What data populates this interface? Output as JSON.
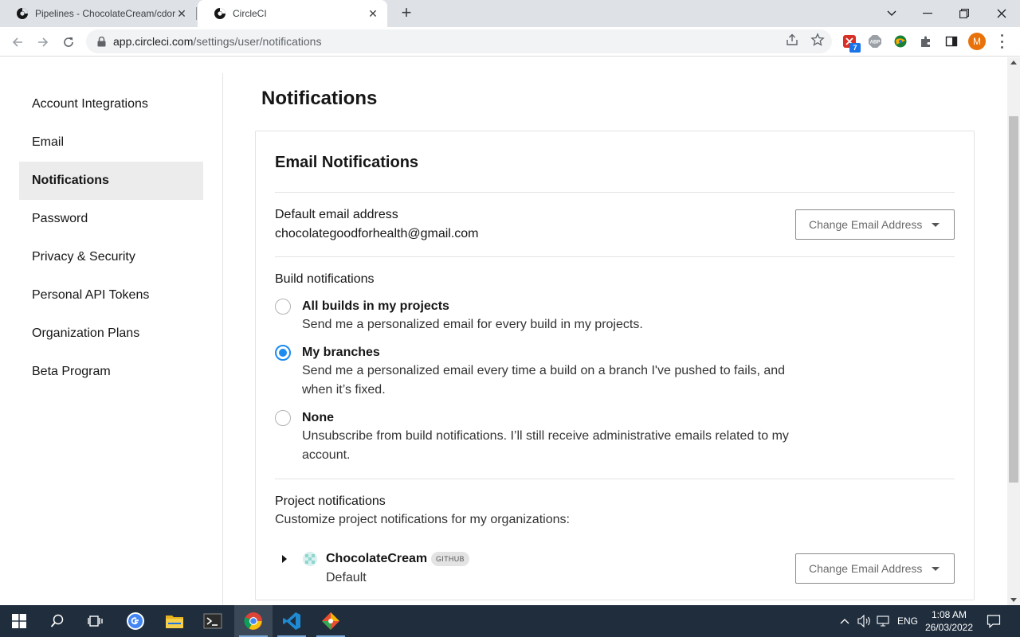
{
  "browser": {
    "tabs": [
      {
        "title": "Pipelines - ChocolateCream/cdor",
        "icon": "circleci-icon",
        "active": false
      },
      {
        "title": "CircleCI",
        "icon": "circleci-icon",
        "active": true
      }
    ],
    "new_tab_symbol": "+",
    "url_host": "app.circleci.com",
    "url_path": "/settings/user/notifications",
    "extension_badge": "7",
    "profile_initial": "M"
  },
  "sidebar": {
    "items": [
      {
        "label": "Account Integrations"
      },
      {
        "label": "Email"
      },
      {
        "label": "Notifications",
        "active": true
      },
      {
        "label": "Password"
      },
      {
        "label": "Privacy & Security"
      },
      {
        "label": "Personal API Tokens"
      },
      {
        "label": "Organization Plans"
      },
      {
        "label": "Beta Program"
      }
    ]
  },
  "main": {
    "title": "Notifications",
    "email_notifications": {
      "heading": "Email Notifications",
      "default_email_label": "Default email address",
      "default_email_value": "chocolategoodforhealth@gmail.com",
      "change_email_button": "Change Email Address",
      "build_notifications_label": "Build notifications",
      "options": [
        {
          "title": "All builds in my projects",
          "description": "Send me a personalized email for every build in my projects.",
          "checked": false
        },
        {
          "title": "My branches",
          "description": "Send me a personalized email every time a build on a branch I've pushed to fails, and when it’s fixed.",
          "checked": true
        },
        {
          "title": "None",
          "description": "Unsubscribe from build notifications. I’ll still receive administrative emails related to my account.",
          "checked": false
        }
      ],
      "project_notifications_label": "Project notifications",
      "project_notifications_desc": "Customize project notifications for my organizations:",
      "organizations": [
        {
          "name": "ChocolateCream",
          "badge": "GITHUB",
          "setting": "Default",
          "button": "Change Email Address"
        }
      ]
    }
  },
  "taskbar": {
    "language": "ENG",
    "time": "1:08 AM",
    "date": "26/03/2022"
  },
  "colors": {
    "accent": "#1a8cf0",
    "sidebar_active_bg": "#ececec",
    "taskbar_bg": "#1f2d3d"
  }
}
